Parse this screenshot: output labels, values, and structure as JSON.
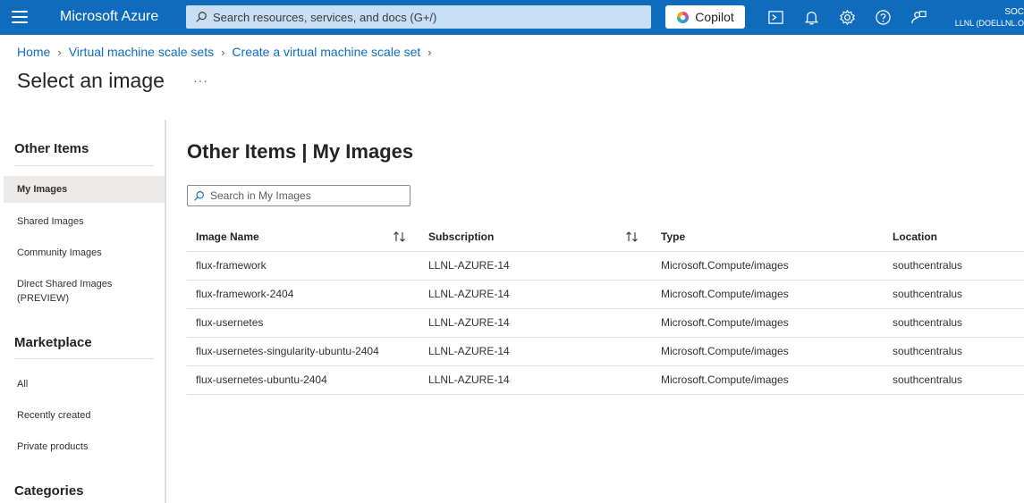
{
  "topbar": {
    "brand": "Microsoft Azure",
    "search_placeholder": "Search resources, services, and docs (G+/)",
    "copilot_label": "Copilot",
    "account_name": "SOC",
    "account_dir": "LLNL (DOELLNL.O",
    "bg_color": "#0f6cbd"
  },
  "breadcrumb": {
    "items": [
      "Home",
      "Virtual machine scale sets",
      "Create a virtual machine scale set"
    ]
  },
  "page": {
    "title": "Select an image",
    "more_label": "···"
  },
  "leftnav": {
    "other_items_heading": "Other Items",
    "other_items": [
      "My Images",
      "Shared Images",
      "Community Images",
      "Direct Shared Images (PREVIEW)"
    ],
    "marketplace_heading": "Marketplace",
    "marketplace_items": [
      "All",
      "Recently created",
      "Private products"
    ],
    "categories_heading": "Categories"
  },
  "main": {
    "title": "Other Items | My Images",
    "search_placeholder": "Search in My Images",
    "columns": [
      "Image Name",
      "Subscription",
      "Type",
      "Location"
    ],
    "rows": [
      [
        "flux-framework",
        "LLNL-AZURE-14",
        "Microsoft.Compute/images",
        "southcentralus"
      ],
      [
        "flux-framework-2404",
        "LLNL-AZURE-14",
        "Microsoft.Compute/images",
        "southcentralus"
      ],
      [
        "flux-usernetes",
        "LLNL-AZURE-14",
        "Microsoft.Compute/images",
        "southcentralus"
      ],
      [
        "flux-usernetes-singularity-ubuntu-2404",
        "LLNL-AZURE-14",
        "Microsoft.Compute/images",
        "southcentralus"
      ],
      [
        "flux-usernetes-ubuntu-2404",
        "LLNL-AZURE-14",
        "Microsoft.Compute/images",
        "southcentralus"
      ]
    ]
  },
  "icons": [
    "menu-icon",
    "search-icon",
    "copilot-icon",
    "cloud-shell-icon",
    "bell-icon",
    "gear-icon",
    "help-icon",
    "feedback-icon",
    "sort-icon"
  ]
}
